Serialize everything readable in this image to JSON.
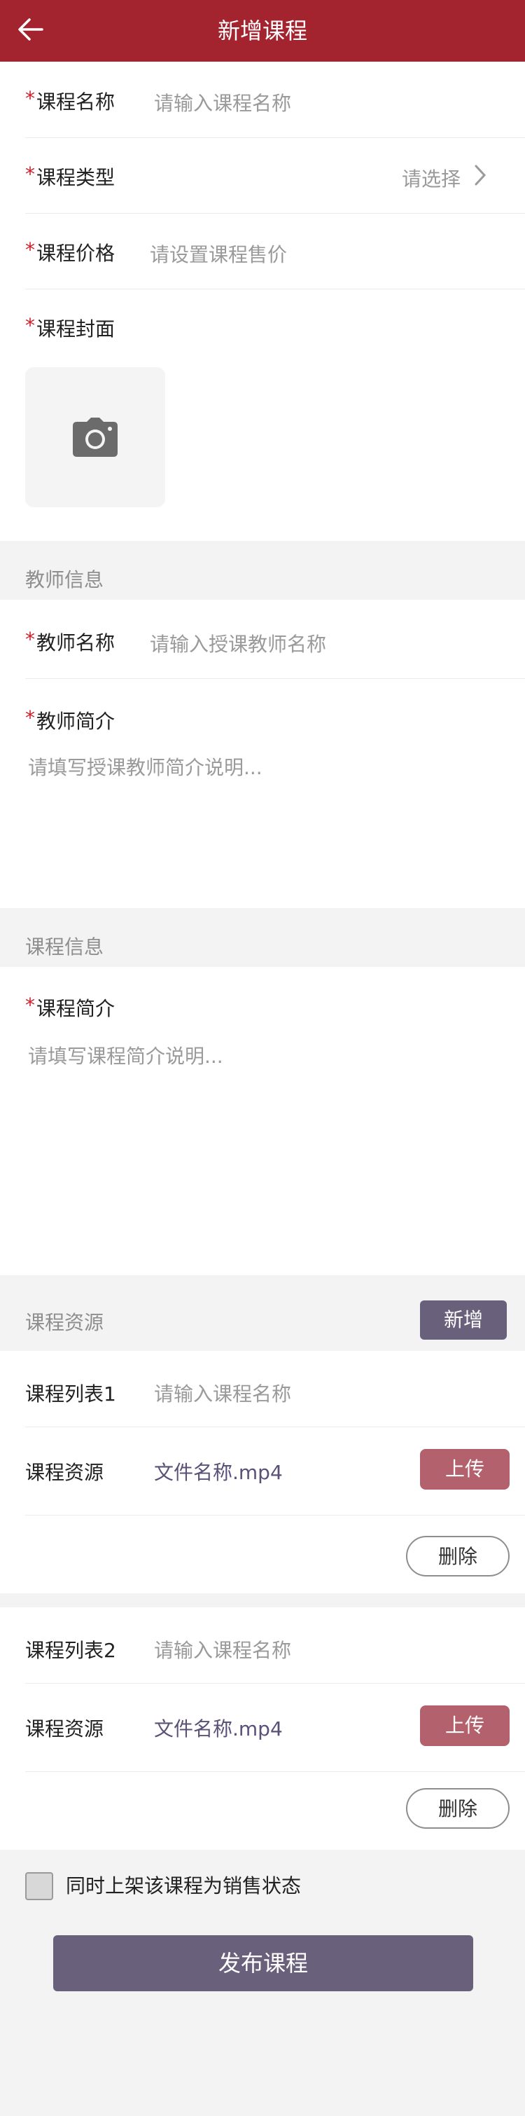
{
  "header": {
    "title": "新增课程"
  },
  "course": {
    "name_label": "课程名称",
    "name_placeholder": "请输入课程名称",
    "type_label": "课程类型",
    "type_value": "请选择",
    "price_label": "课程价格",
    "price_placeholder": "请设置课程售价",
    "cover_label": "课程封面",
    "required_mark": "*"
  },
  "teacher": {
    "section_title": "教师信息",
    "name_label": "教师名称",
    "name_placeholder": "请输入授课教师名称",
    "intro_label": "教师简介",
    "intro_placeholder": "请填写授课教师简介说明..."
  },
  "course_info": {
    "section_title": "课程信息",
    "intro_label": "课程简介",
    "intro_placeholder": "请填写课程简介说明..."
  },
  "resources": {
    "section_title": "课程资源",
    "add_label": "新增",
    "items": [
      {
        "list_label": "课程列表1",
        "list_placeholder": "请输入课程名称",
        "resource_label": "课程资源",
        "file_name": "文件名称.mp4",
        "upload_label": "上传",
        "delete_label": "删除"
      },
      {
        "list_label": "课程列表2",
        "list_placeholder": "请输入课程名称",
        "resource_label": "课程资源",
        "file_name": "文件名称.mp4",
        "upload_label": "上传",
        "delete_label": "删除"
      }
    ]
  },
  "footer": {
    "checkbox_label": "同时上架该课程为销售状态",
    "publish_label": "发布课程"
  },
  "colors": {
    "brand": "#a3242f",
    "accent": "#69607c",
    "upload": "#b3616c",
    "required": "#d0202a"
  }
}
